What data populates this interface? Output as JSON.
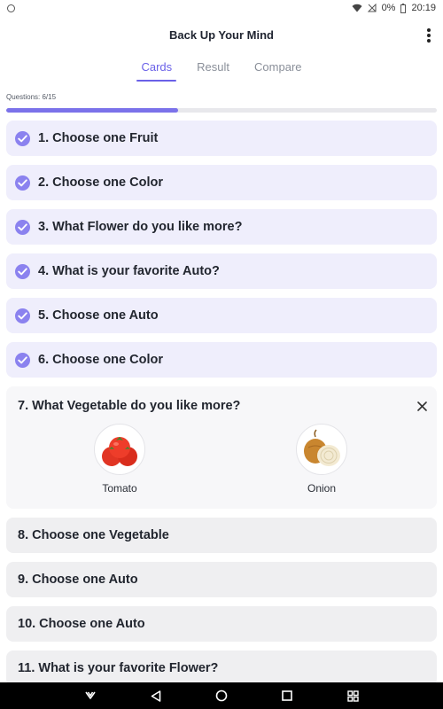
{
  "status_bar": {
    "battery": "0%",
    "time": "20:19"
  },
  "app": {
    "title": "Back Up Your Mind"
  },
  "tabs": [
    {
      "label": "Cards",
      "active": true
    },
    {
      "label": "Result",
      "active": false
    },
    {
      "label": "Compare",
      "active": false
    }
  ],
  "progress": {
    "label": "Questions: 6/15",
    "answered": 6,
    "total": 15,
    "fraction": 0.4
  },
  "questions": [
    {
      "text": "1. Choose one Fruit",
      "state": "answered"
    },
    {
      "text": "2. Choose one Color",
      "state": "answered"
    },
    {
      "text": "3. What Flower do you like more?",
      "state": "answered"
    },
    {
      "text": "4. What is your favorite Auto?",
      "state": "answered"
    },
    {
      "text": "5. Choose one Auto",
      "state": "answered"
    },
    {
      "text": "6. Choose one Color",
      "state": "answered"
    },
    {
      "text": "7. What Vegetable do you like more?",
      "state": "open",
      "options": [
        {
          "label": "Tomato",
          "icon": "tomato-icon"
        },
        {
          "label": "Onion",
          "icon": "onion-icon"
        }
      ]
    },
    {
      "text": "8. Choose one Vegetable",
      "state": "unanswered"
    },
    {
      "text": "9. Choose one Auto",
      "state": "unanswered"
    },
    {
      "text": "10. Choose one Auto",
      "state": "unanswered"
    },
    {
      "text": "11. What is your favorite Flower?",
      "state": "unanswered"
    }
  ],
  "colors": {
    "accent": "#6a61e8",
    "check": "#8b82ef",
    "answered_card": "#efeefc",
    "unanswered_card": "#efeff1"
  }
}
